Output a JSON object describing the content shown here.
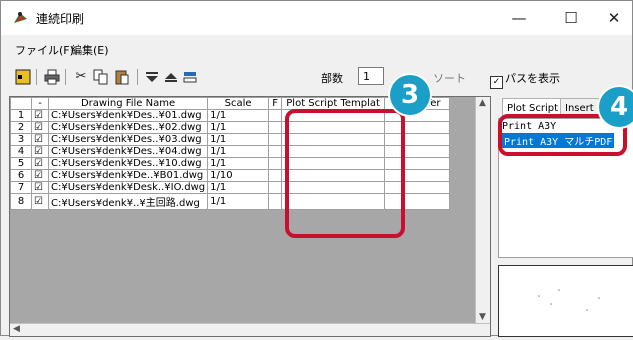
{
  "window": {
    "title": "連続印刷",
    "minimize_glyph": "—",
    "maximize_glyph": "☐",
    "close_glyph": "✕"
  },
  "menu": {
    "file": "ファイル(F)",
    "edit": "編集(E)"
  },
  "toolbar": {
    "copies_label": "部数",
    "copies_value": "1",
    "sort_label": "ソート",
    "show_path_label": "パスを表示",
    "show_path_checked": true
  },
  "grid": {
    "columns": [
      "",
      "-",
      "Drawing File Name",
      "Scale",
      "F",
      "Plot Script Templat",
      "Script Ter"
    ],
    "rows": [
      {
        "n": "1",
        "check": "☑",
        "file": "C:¥Users¥denk¥Des..¥01.dwg",
        "scale": "1/1"
      },
      {
        "n": "2",
        "check": "☑",
        "file": "C:¥Users¥denk¥Des..¥02.dwg",
        "scale": "1/1"
      },
      {
        "n": "3",
        "check": "☑",
        "file": "C:¥Users¥denk¥Des..¥03.dwg",
        "scale": "1/1"
      },
      {
        "n": "4",
        "check": "☑",
        "file": "C:¥Users¥denk¥Des..¥04.dwg",
        "scale": "1/1"
      },
      {
        "n": "5",
        "check": "☑",
        "file": "C:¥Users¥denk¥Des..¥10.dwg",
        "scale": "1/1"
      },
      {
        "n": "6",
        "check": "☑",
        "file": "C:¥Users¥denk¥De..¥B01.dwg",
        "scale": "1/10"
      },
      {
        "n": "7",
        "check": "☑",
        "file": "C:¥Users¥denk¥Desk..¥IO.dwg",
        "scale": "1/1"
      },
      {
        "n": "8",
        "check": "☑",
        "file": "C:¥Users¥denk¥..¥主回路.dwg",
        "scale": "1/1"
      }
    ]
  },
  "panel": {
    "tabs": [
      "Plot Script",
      "Insert"
    ],
    "items": [
      "Print A3Y",
      "Print A3Y マルチPDF"
    ]
  },
  "callouts": {
    "three": "3",
    "four": "4"
  },
  "colors": {
    "callout_red": "#c8102e",
    "badge_blue": "#1aa0c8",
    "selection_blue": "#0078d7"
  }
}
